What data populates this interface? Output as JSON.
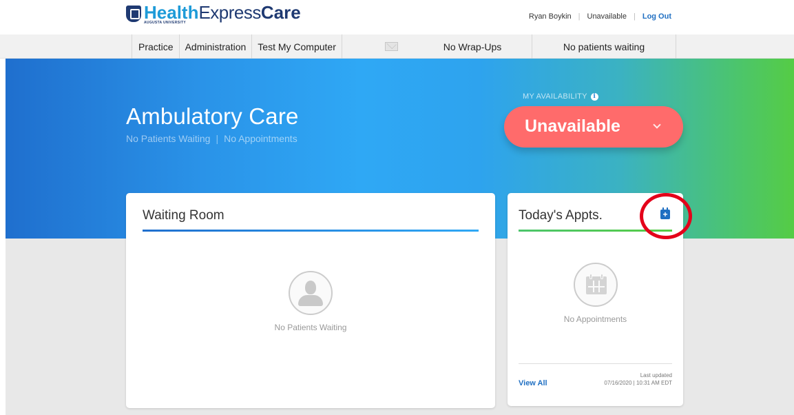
{
  "brand": {
    "health": "Health",
    "express": "Express",
    "care": "Care",
    "university": "AUGUSTA UNIVERSITY"
  },
  "userbar": {
    "user_name": "Ryan Boykin",
    "status": "Unavailable",
    "logout_label": "Log Out"
  },
  "nav": {
    "items": [
      {
        "label": "Practice"
      },
      {
        "label": "Administration"
      },
      {
        "label": "Test My Computer"
      }
    ],
    "wrapups": "No Wrap-Ups",
    "patients_waiting": "No patients waiting",
    "mail_icon": "envelope-icon"
  },
  "hero": {
    "title": "Ambulatory Care",
    "sub_patients": "No Patients Waiting",
    "sub_appts": "No Appointments",
    "availability_label": "MY AVAILABILITY",
    "info_icon": "i",
    "availability_value": "Unavailable"
  },
  "waiting_room": {
    "title": "Waiting Room",
    "empty_text": "No Patients Waiting"
  },
  "appointments": {
    "title": "Today's Appts.",
    "empty_text": "No Appointments",
    "view_all": "View All",
    "last_updated_label": "Last updated",
    "last_updated_value": "07/16/2020 | 10:31 AM EDT"
  },
  "colors": {
    "brand_blue": "#1e9bd8",
    "brand_navy": "#1f3a72",
    "unavailable": "#ff6b6b",
    "highlight": "#e4001a"
  }
}
